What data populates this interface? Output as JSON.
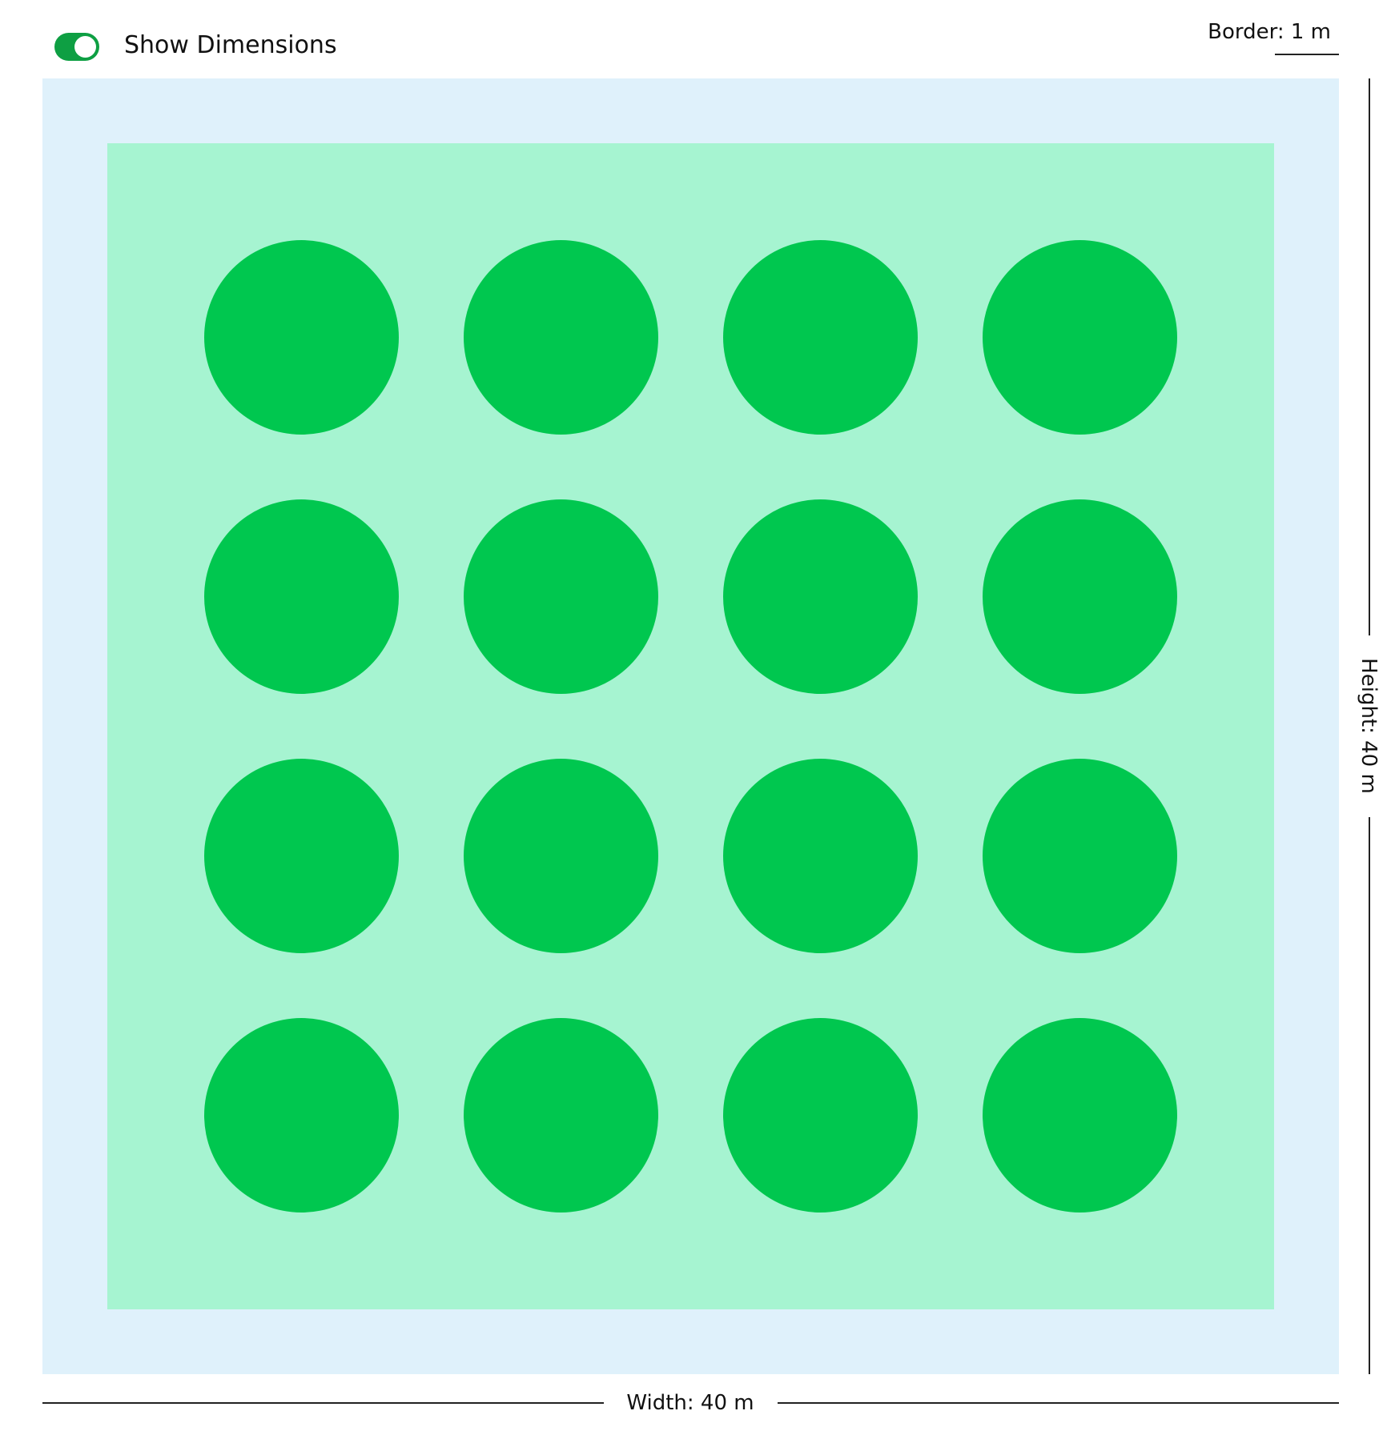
{
  "controls": {
    "show_dimensions": {
      "label": "Show Dimensions",
      "checked": true
    }
  },
  "dimensions": {
    "border_label": "Border: 1 m",
    "height_label": "Height: 40 m",
    "width_label": "Width: 40 m"
  },
  "layout_grid": {
    "rows": 4,
    "columns": 4,
    "plant_count": 16
  },
  "colors": {
    "toggle_on": "#0e9f43",
    "border_area": "#dff1fb",
    "growing_area": "#a6f4d1",
    "plant": "#00c74f",
    "dimension_line": "#222222"
  }
}
